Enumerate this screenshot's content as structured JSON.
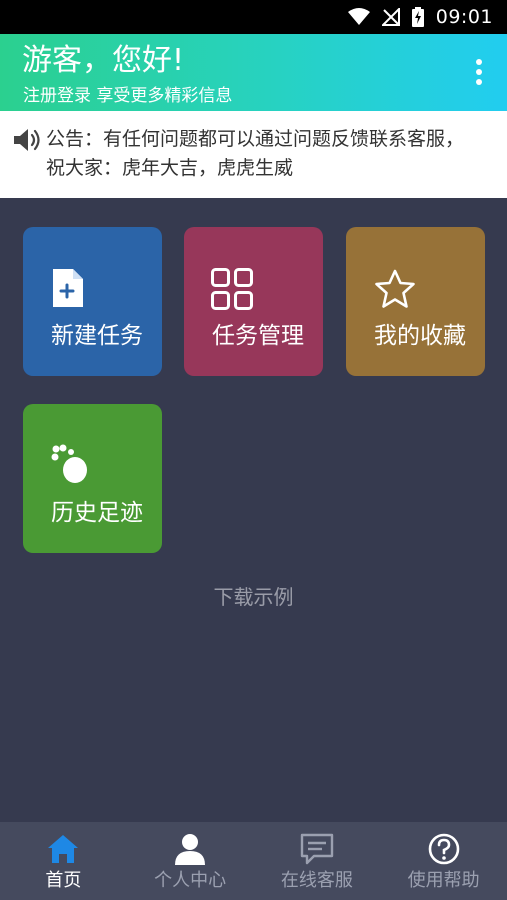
{
  "status_bar": {
    "time": "09:01"
  },
  "header": {
    "greeting": "游客，您好!",
    "subtitle": "注册登录 享受更多精彩信息"
  },
  "notice": {
    "text": "公告：有任何问题都可以通过问题反馈联系客服，祝大家：虎年大吉，虎虎生威"
  },
  "tiles": [
    {
      "label": "新建任务",
      "icon": "new-file-icon",
      "color": "#2b64a8"
    },
    {
      "label": "任务管理",
      "icon": "grid-icon",
      "color": "#97375a"
    },
    {
      "label": "我的收藏",
      "icon": "star-icon",
      "color": "#977238"
    },
    {
      "label": "历史足迹",
      "icon": "footprint-icon",
      "color": "#4a9a34"
    }
  ],
  "download_example": "下载示例",
  "tab_bar": {
    "tabs": [
      {
        "label": "首页",
        "icon": "home-icon",
        "active": true
      },
      {
        "label": "个人中心",
        "icon": "person-icon",
        "active": false
      },
      {
        "label": "在线客服",
        "icon": "chat-icon",
        "active": false
      },
      {
        "label": "使用帮助",
        "icon": "help-icon",
        "active": false
      }
    ],
    "active_color": "#1e88e5"
  }
}
